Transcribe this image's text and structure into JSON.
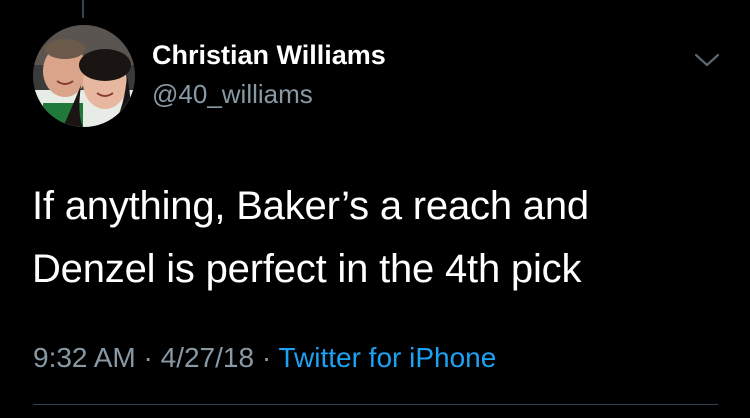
{
  "tweet": {
    "author": {
      "display_name": "Christian Williams",
      "handle": "@40_williams",
      "avatar_icon": "profile-photo"
    },
    "text_lines": [
      "If anything, Baker’s a reach and",
      "Denzel is perfect in the 4th pick"
    ],
    "meta": {
      "time": "9:32 AM",
      "separator": "·",
      "date": "4/27/18",
      "source": "Twitter for iPhone"
    },
    "menu_icon": "chevron-down-icon"
  },
  "colors": {
    "background": "#000000",
    "primary_text": "#ffffff",
    "secondary_text": "#8899a6",
    "link": "#1da1f2",
    "divider": "#38444d"
  }
}
